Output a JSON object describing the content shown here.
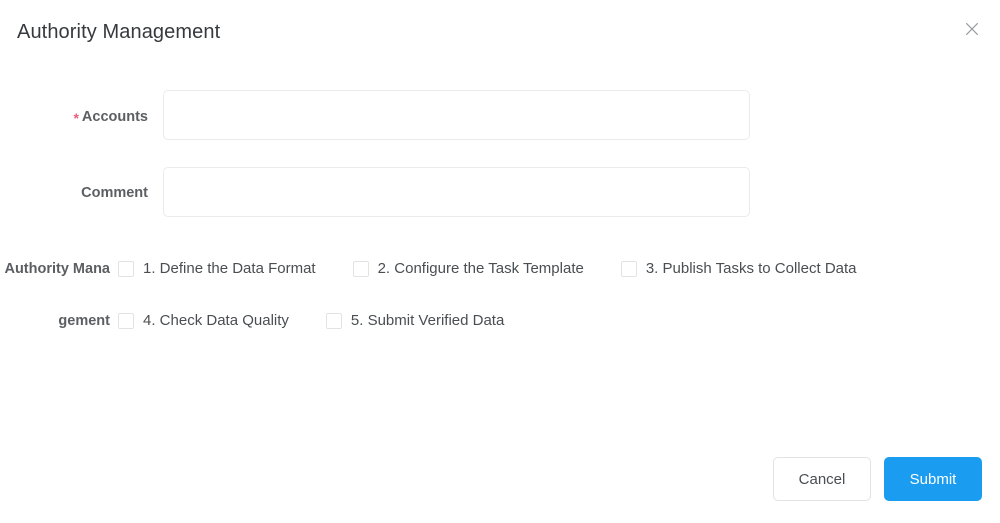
{
  "dialog": {
    "title": "Authority Management",
    "close_icon": "close-icon"
  },
  "form": {
    "fields": [
      {
        "label": "Accounts",
        "required": true,
        "required_marker": "*",
        "value": "",
        "placeholder": ""
      },
      {
        "label": "Comment",
        "required": false,
        "required_marker": "",
        "value": "",
        "placeholder": ""
      }
    ],
    "authority": {
      "label": "Authority Management",
      "options": [
        {
          "label": "1. Define the Data Format",
          "checked": false
        },
        {
          "label": "2. Configure the Task Template",
          "checked": false
        },
        {
          "label": "3. Publish Tasks to Collect Data",
          "checked": false
        },
        {
          "label": "4. Check Data Quality",
          "checked": false
        },
        {
          "label": "5. Submit Verified Data",
          "checked": false
        }
      ]
    }
  },
  "footer": {
    "cancel_label": "Cancel",
    "submit_label": "Submit"
  },
  "colors": {
    "accent": "#1a9df0",
    "required": "#e8607d",
    "label_text": "#5b5f63",
    "body_text": "#4a4e52",
    "border": "#ebebeb"
  }
}
